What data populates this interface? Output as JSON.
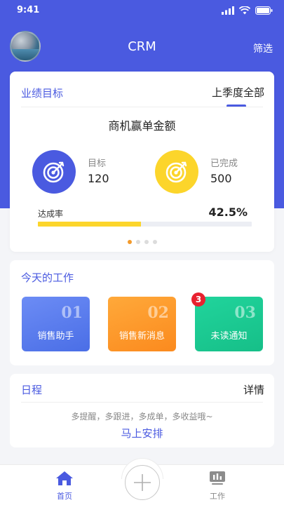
{
  "status_bar": {
    "time": "9:41"
  },
  "nav": {
    "title": "CRM",
    "filter_label": "筛选"
  },
  "performance": {
    "title": "业绩目标",
    "period": "上季度全部",
    "metric_title": "商机赢单金额",
    "target": {
      "label": "目标",
      "value": "120"
    },
    "completed": {
      "label": "已完成",
      "value": "500"
    },
    "rate": {
      "label": "达成率",
      "value": "42.5%",
      "progress_fraction": 0.483
    },
    "pager": {
      "pages": 4,
      "active_index": 0
    }
  },
  "today_work": {
    "title": "今天的工作",
    "tiles": [
      {
        "number": "01",
        "label": "销售助手"
      },
      {
        "number": "02",
        "label": "销售新消息"
      },
      {
        "number": "03",
        "label": "未读通知",
        "badge": "3"
      }
    ]
  },
  "schedule": {
    "title": "日程",
    "detail_label": "详情",
    "hint": "多提醒，多跟进，多成单，多收益哦~",
    "action_label": "马上安排"
  },
  "tabbar": {
    "home_label": "首页",
    "work_label": "工作",
    "icons": {
      "home": "home-icon",
      "add": "plus-icon",
      "work": "chart-icon"
    }
  },
  "colors": {
    "primary": "#4a5ae0",
    "yellow": "#fcd52b",
    "orange": "#fb8a1e",
    "green": "#16bf88",
    "badge_red": "#e8212f",
    "active_dot": "#f39a2b"
  }
}
